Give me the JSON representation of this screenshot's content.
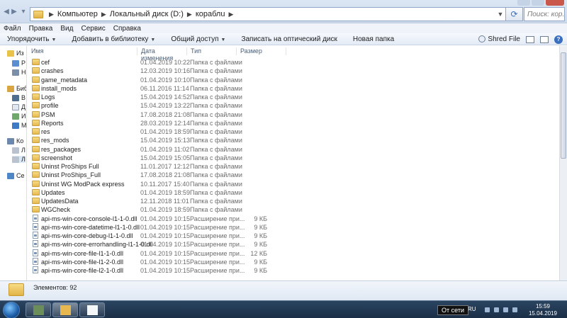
{
  "address": {
    "segments": [
      "Компьютер",
      "Локальный диск (D:)",
      "кораблu"
    ],
    "search_placeholder": "Поиск: кор..."
  },
  "menu": [
    "Файл",
    "Правка",
    "Вид",
    "Сервис",
    "Справка"
  ],
  "toolbar": {
    "organize": "Упорядочить",
    "add_to_library": "Добавить в библиотеку",
    "share": "Общий доступ",
    "burn": "Записать на оптический диск",
    "new_folder": "Новая папка",
    "shred_file": "Shred File"
  },
  "sidebar": [
    "Из",
    "Р",
    "Н",
    "Биб",
    "В",
    "Д",
    "И",
    "М",
    "Ко",
    "Л",
    "Л",
    "Се"
  ],
  "columns": {
    "name": "Имя",
    "date": "Дата изменения",
    "type": "Тип",
    "size": "Размер"
  },
  "files": [
    {
      "name": "cef",
      "date": "01.04.2019 10:22",
      "type": "Папка с файлами",
      "size": "",
      "kind": "folder"
    },
    {
      "name": "crashes",
      "date": "12.03.2019 10:16",
      "type": "Папка с файлами",
      "size": "",
      "kind": "folder"
    },
    {
      "name": "game_metadata",
      "date": "01.04.2019 10:10",
      "type": "Папка с файлами",
      "size": "",
      "kind": "folder"
    },
    {
      "name": "install_mods",
      "date": "06.11.2016 11:14",
      "type": "Папка с файлами",
      "size": "",
      "kind": "folder"
    },
    {
      "name": "Logs",
      "date": "15.04.2019 14:52",
      "type": "Папка с файлами",
      "size": "",
      "kind": "folder"
    },
    {
      "name": "profile",
      "date": "15.04.2019 13:22",
      "type": "Папка с файлами",
      "size": "",
      "kind": "folder"
    },
    {
      "name": "PSM",
      "date": "17.08.2018 21:08",
      "type": "Папка с файлами",
      "size": "",
      "kind": "folder"
    },
    {
      "name": "Reports",
      "date": "28.03.2019 12:14",
      "type": "Папка с файлами",
      "size": "",
      "kind": "folder"
    },
    {
      "name": "res",
      "date": "01.04.2019 18:59",
      "type": "Папка с файлами",
      "size": "",
      "kind": "folder"
    },
    {
      "name": "res_mods",
      "date": "15.04.2019 15:13",
      "type": "Папка с файлами",
      "size": "",
      "kind": "folder"
    },
    {
      "name": "res_packages",
      "date": "01.04.2019 11:02",
      "type": "Папка с файлами",
      "size": "",
      "kind": "folder"
    },
    {
      "name": "screenshot",
      "date": "15.04.2019 15:05",
      "type": "Папка с файлами",
      "size": "",
      "kind": "folder"
    },
    {
      "name": "Uninst ProShips Full",
      "date": "11.01.2017 12:12",
      "type": "Папка с файлами",
      "size": "",
      "kind": "folder"
    },
    {
      "name": "Uninst ProShips_Full",
      "date": "17.08.2018 21:08",
      "type": "Папка с файлами",
      "size": "",
      "kind": "folder"
    },
    {
      "name": "Uninst WG ModPack express",
      "date": "10.11.2017 15:40",
      "type": "Папка с файлами",
      "size": "",
      "kind": "folder"
    },
    {
      "name": "Updates",
      "date": "01.04.2019 18:59",
      "type": "Папка с файлами",
      "size": "",
      "kind": "folder"
    },
    {
      "name": "UpdatesData",
      "date": "12.11.2018 11:01",
      "type": "Папка с файлами",
      "size": "",
      "kind": "folder"
    },
    {
      "name": "WGCheck",
      "date": "01.04.2019 18:59",
      "type": "Папка с файлами",
      "size": "",
      "kind": "folder"
    },
    {
      "name": "api-ms-win-core-console-l1-1-0.dll",
      "date": "01.04.2019 10:15",
      "type": "Расширение при...",
      "size": "9 КБ",
      "kind": "dll"
    },
    {
      "name": "api-ms-win-core-datetime-l1-1-0.dll",
      "date": "01.04.2019 10:15",
      "type": "Расширение при...",
      "size": "9 КБ",
      "kind": "dll"
    },
    {
      "name": "api-ms-win-core-debug-l1-1-0.dll",
      "date": "01.04.2019 10:15",
      "type": "Расширение при...",
      "size": "9 КБ",
      "kind": "dll"
    },
    {
      "name": "api-ms-win-core-errorhandling-l1-1-0.dll",
      "date": "01.04.2019 10:15",
      "type": "Расширение при...",
      "size": "9 КБ",
      "kind": "dll"
    },
    {
      "name": "api-ms-win-core-file-l1-1-0.dll",
      "date": "01.04.2019 10:15",
      "type": "Расширение при...",
      "size": "12 КБ",
      "kind": "dll"
    },
    {
      "name": "api-ms-win-core-file-l1-2-0.dll",
      "date": "01.04.2019 10:15",
      "type": "Расширение при...",
      "size": "9 КБ",
      "kind": "dll"
    },
    {
      "name": "api-ms-win-core-file-l2-1-0.dll",
      "date": "01.04.2019 10:15",
      "type": "Расширение при...",
      "size": "9 КБ",
      "kind": "dll"
    }
  ],
  "status": {
    "items_count": "Элементов: 92"
  },
  "taskbar": {
    "tooltip": "От сети",
    "language": "RU",
    "time": "15:59",
    "date": "15.04.2019"
  },
  "colors": {
    "folder": "#e6b84f",
    "accent": "#3a6fbf",
    "taskbar": "#1b2f47"
  }
}
